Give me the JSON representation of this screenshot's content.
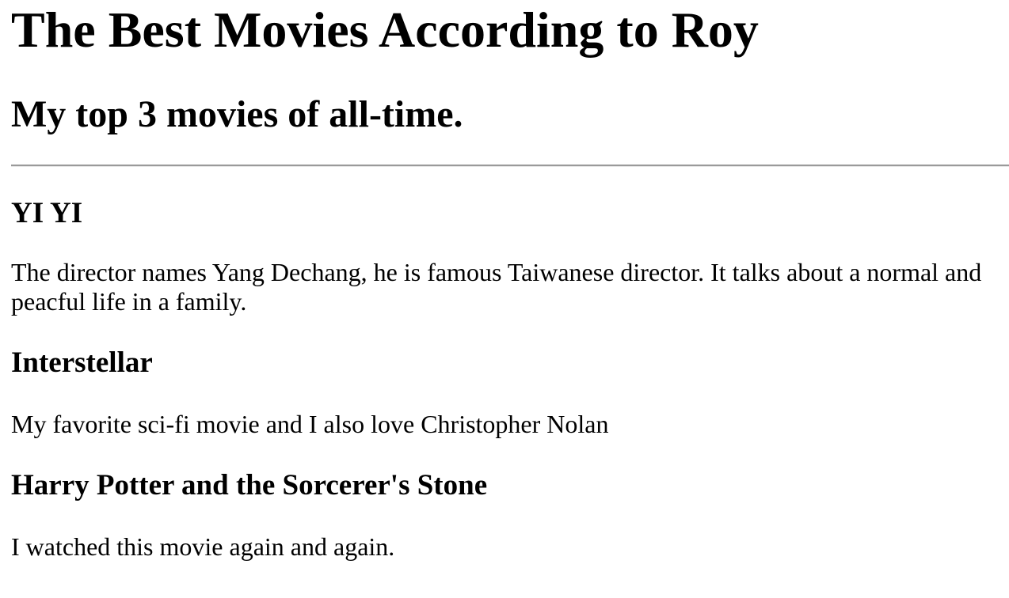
{
  "page": {
    "title": "The Best Movies According to Roy",
    "subtitle": "My top 3 movies of all-time."
  },
  "movies": [
    {
      "title": "YI YI",
      "description": "The director names Yang Dechang, he is famous Taiwanese director. It talks about a normal and peacful life in a family."
    },
    {
      "title": "Interstellar",
      "description": "My favorite sci-fi movie and I also love Christopher Nolan"
    },
    {
      "title": "Harry Potter and the Sorcerer's Stone",
      "description": "I watched this movie again and again."
    }
  ]
}
